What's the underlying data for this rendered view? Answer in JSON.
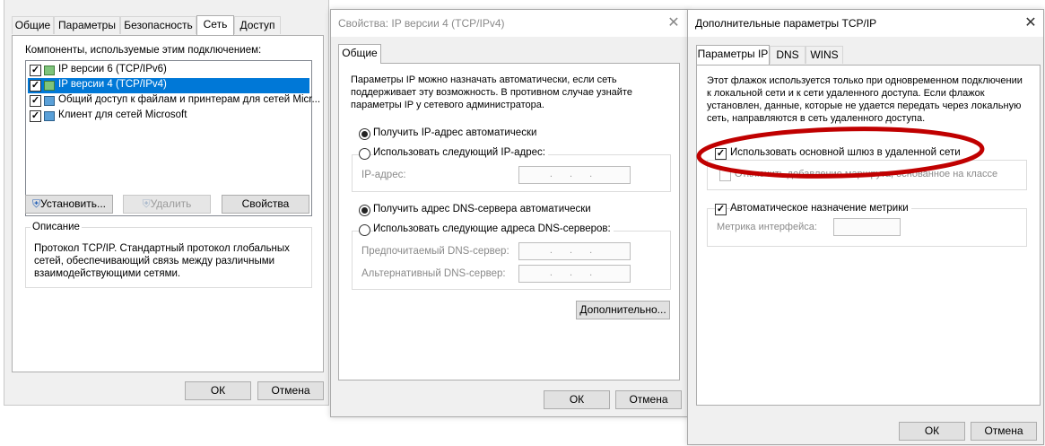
{
  "win1": {
    "tabs": [
      "Общие",
      "Параметры",
      "Безопасность",
      "Сеть",
      "Доступ"
    ],
    "active_tab": "Сеть",
    "components_label": "Компоненты, используемые этим подключением:",
    "components": [
      {
        "label": "IP версии 6 (TCP/IPv6)",
        "checked": true,
        "selected": false
      },
      {
        "label": "IP версии 4 (TCP/IPv4)",
        "checked": true,
        "selected": true
      },
      {
        "label": "Общий доступ к файлам и принтерам для сетей Micr...",
        "checked": true,
        "selected": false
      },
      {
        "label": "Клиент для сетей Microsoft",
        "checked": true,
        "selected": false
      }
    ],
    "install_button": "Установить...",
    "remove_button": "Удалить",
    "properties_button": "Свойства",
    "description_title": "Описание",
    "description_text": "Протокол TCP/IP. Стандартный протокол глобальных сетей, обеспечивающий связь между различными взаимодействующими сетями.",
    "ok_button": "ОК",
    "cancel_button": "Отмена"
  },
  "win2": {
    "title": "Свойства: IP версии 4 (TCP/IPv4)",
    "close_icon": "close-icon",
    "tab": "Общие",
    "intro": "Параметры IP можно назначать автоматически, если сеть поддерживает эту возможность. В противном случае узнайте параметры IP у сетевого администратора.",
    "radio_ip_auto": "Получить IP-адрес автоматически",
    "radio_ip_manual": "Использовать следующий IP-адрес:",
    "ip_label": "IP-адрес:",
    "ip_value": ". . .",
    "radio_dns_auto": "Получить адрес DNS-сервера автоматически",
    "radio_dns_manual": "Использовать следующие адреса DNS-серверов:",
    "dns_pref_label": "Предпочитаемый DNS-сервер:",
    "dns_pref_value": ". . .",
    "dns_alt_label": "Альтернативный DNS-сервер:",
    "dns_alt_value": ". . .",
    "advanced_button": "Дополнительно...",
    "ok_button": "ОК",
    "cancel_button": "Отмена"
  },
  "win3": {
    "title": "Дополнительные параметры TCP/IP",
    "close_icon": "close-icon",
    "tabs": [
      "Параметры IP",
      "DNS",
      "WINS"
    ],
    "active_tab": "Параметры IP",
    "intro": "Этот флажок используется только при одновременном подключении к локальной сети и к сети удаленного доступа. Если флажок установлен, данные, которые не удается передать через локальную сеть, направляются в сеть удаленного доступа.",
    "use_gateway": "Использовать основной шлюз в удаленной сети",
    "use_gateway_checked": true,
    "disable_class_route": "Отключить добавление маршрута, основанное на классе",
    "auto_metric": "Автоматическое назначение метрики",
    "auto_metric_checked": true,
    "metric_label": "Метрика интерфейса:",
    "metric_value": "",
    "ok_button": "ОК",
    "cancel_button": "Отмена",
    "highlight_color": "#c00000"
  }
}
